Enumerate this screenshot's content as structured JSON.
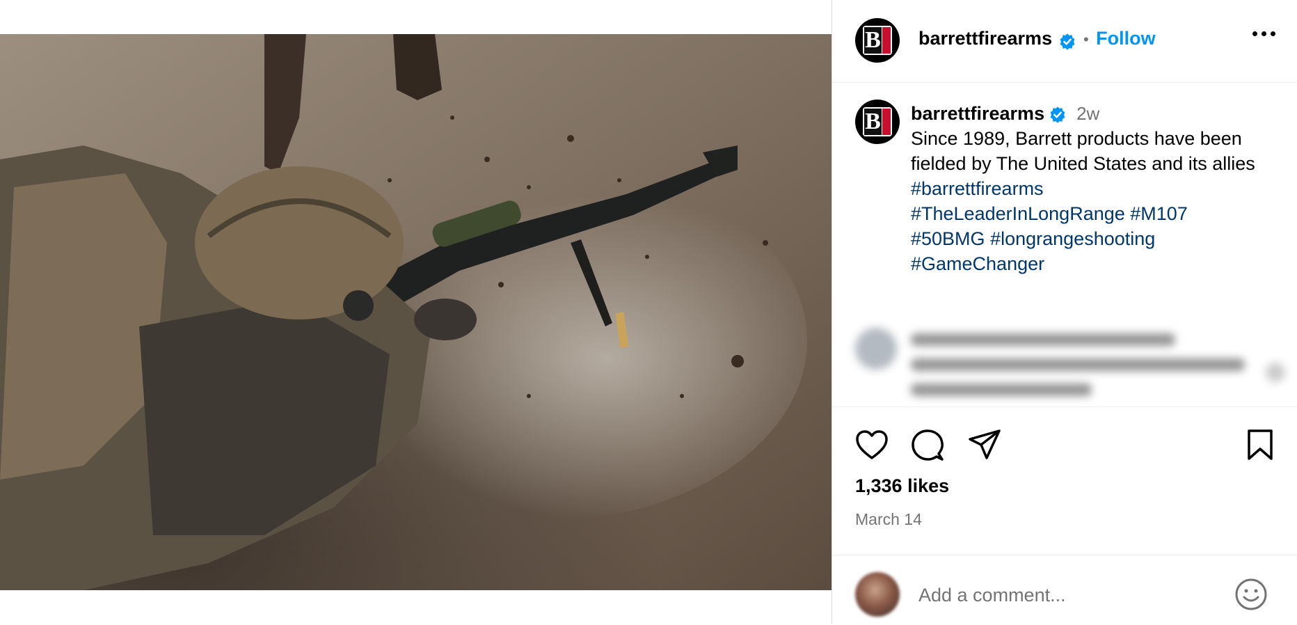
{
  "post": {
    "username": "barrettfirearms",
    "follow_label": "Follow",
    "separator": "•",
    "caption": {
      "username": "barrettfirearms",
      "time_ago": "2w",
      "text": "Since 1989, Barrett products have been fielded by The United States and its allies",
      "hashtags": [
        "#barrettfirearms",
        "#TheLeaderInLongRange",
        "#M107",
        "#50BMG",
        "#longrangeshooting",
        "#GameChanger"
      ]
    },
    "likes": "1,336 likes",
    "date": "March 14",
    "comment_placeholder": "Add a comment..."
  },
  "media": {
    "description": "Soldier in camouflage firing a rifle prone in the dirt"
  },
  "icons": {
    "avatar": "barrett-logo-icon",
    "verified": "verified-badge-icon",
    "more": "more-options-icon",
    "like": "heart-icon",
    "comment": "comment-bubble-icon",
    "share": "paper-plane-icon",
    "save": "bookmark-icon",
    "emoji": "smiley-face-icon"
  },
  "colors": {
    "follow": "#0095f6",
    "hashtag": "#00376b",
    "verified": "#0095f6",
    "brand_red": "#c8102e"
  }
}
